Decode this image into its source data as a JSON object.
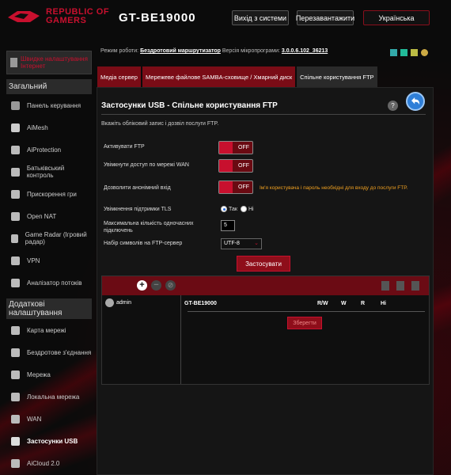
{
  "header": {
    "brand_line1": "REPUBLIC OF",
    "brand_line2": "GAMERS",
    "model": "GT-BE19000",
    "logout": "Вихід з системи",
    "reboot": "Перезавантажити",
    "language": "Українська"
  },
  "nav": {
    "quick_setup": "Швидке налаштування Інтернет",
    "section_general": "Загальний",
    "general_items": [
      {
        "label": "Панель керування",
        "icon": "dashboard-icon"
      },
      {
        "label": "AiMesh",
        "icon": "mesh-icon"
      },
      {
        "label": "AiProtection",
        "icon": "shield-icon"
      },
      {
        "label": "Батьківський контроль",
        "icon": "parental-icon"
      },
      {
        "label": "Прискорення гри",
        "icon": "rocket-icon"
      },
      {
        "label": "Open NAT",
        "icon": "nat-icon"
      },
      {
        "label": "Game Radar (Ігровий радар)",
        "icon": "radar-icon"
      },
      {
        "label": "VPN",
        "icon": "vpn-icon"
      },
      {
        "label": "Аналізатор потоків",
        "icon": "traffic-icon"
      }
    ],
    "section_advanced": "Додаткові налаштування",
    "advanced_items": [
      {
        "label": "Карта мережі",
        "icon": "map-icon"
      },
      {
        "label": "Бездротове з'єднання",
        "icon": "wireless-icon"
      },
      {
        "label": "Мережа",
        "icon": "network-icon"
      },
      {
        "label": "Локальна мережа",
        "icon": "lan-icon"
      },
      {
        "label": "WAN",
        "icon": "wan-icon"
      },
      {
        "label": "Застосунки USB",
        "icon": "usb-icon"
      },
      {
        "label": "AiCloud 2.0",
        "icon": "cloud-icon"
      }
    ]
  },
  "status": {
    "mode_label": "Режим роботи:",
    "mode_value": "Бездротовий маршрутизатор",
    "fw_label": "Версія мікропрограми:",
    "fw_value": "3.0.0.6.102_36213"
  },
  "tabs": [
    {
      "label": "Медіа сервер",
      "active": false
    },
    {
      "label": "Мережеве файлове SAMBA-сховище / Хмарний диск",
      "active": false
    },
    {
      "label": "Спільне користування FTP",
      "active": true
    }
  ],
  "page": {
    "title": "Застосунки USB - Спільне користування FTP",
    "description": "Вкажіть обліковий запис і дозвіл послуги FTP.",
    "enable_ftp_label": "Активувати FTP",
    "wan_access_label": "Увімкнути доступ по мережі WAN",
    "anonymous_label": "Дозволити анонімний вхід",
    "anonymous_hint": "Ім'я користувача і пароль необхідні для входу до послуги FTP.",
    "toggle_off": "OFF",
    "tls_label": "Увімкнення підтримки TLS",
    "tls_yes": "Так",
    "tls_no": "Ні",
    "max_conn_label": "Максимальна кількість одночасних підключень",
    "max_conn_value": "5",
    "charset_label": "Набір символів на FTP-сервер",
    "charset_value": "UTF-8",
    "apply": "Застосувати"
  },
  "accounts": {
    "add": "+",
    "remove": "−",
    "edit": "⊘",
    "users": [
      "admin"
    ],
    "share_name": "GT-BE19000",
    "perm_rw": "R/W",
    "perm_w": "W",
    "perm_r": "R",
    "perm_none": "Ні",
    "save": "Зберегти"
  }
}
